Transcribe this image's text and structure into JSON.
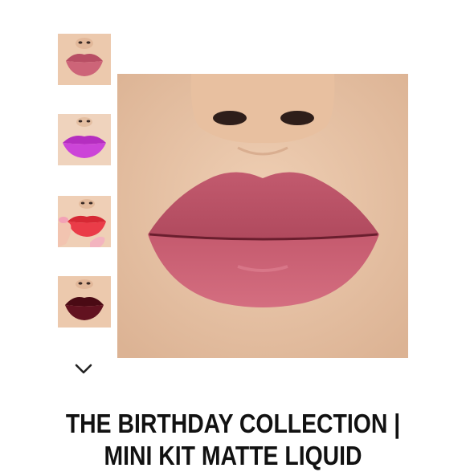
{
  "product": {
    "title_line1": "THE BIRTHDAY COLLECTION |",
    "title_line2": "MINI KIT MATTE LIQUID"
  },
  "gallery": {
    "thumbnails": [
      {
        "shade": "mauve-pink",
        "lip_color": "#c45a6e",
        "selected": true
      },
      {
        "shade": "magenta",
        "lip_color": "#c43ad0",
        "selected": false
      },
      {
        "shade": "red",
        "lip_color": "#e23240",
        "selected": false
      },
      {
        "shade": "burgundy",
        "lip_color": "#5a0e18",
        "selected": false
      }
    ],
    "scroll_icon": "chevron-down-icon",
    "main_image_shade": "mauve-pink"
  },
  "colors": {
    "skin": "#e8c6a8",
    "main_lip": "#c25569",
    "title_text": "#111111"
  }
}
